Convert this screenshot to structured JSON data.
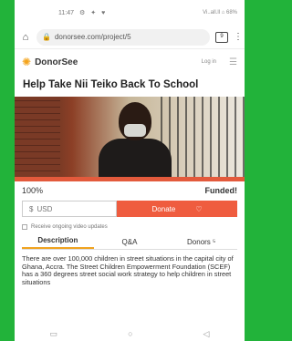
{
  "status_bar": {
    "time": "11:47",
    "left_icons": [
      "settings-icon",
      "bluetooth-icon",
      "wifi-icon"
    ],
    "right_text": "Vi..all.ll ⌂ 68%"
  },
  "browser": {
    "home_icon": "home-icon",
    "url": "donorsee.com/project/5",
    "lock_icon": "lock-icon",
    "tabs_count": "9",
    "menu_icon": "kebab-icon"
  },
  "site": {
    "logo": "DonorSee",
    "login": "Log in",
    "menu_icon": "hamburger-icon"
  },
  "project": {
    "title": "Help Take Nii Teiko Back To School",
    "progress_percent": 100,
    "progress_label": "100%",
    "funded_label": "Funded!"
  },
  "donation": {
    "currency_prefix": "$",
    "currency_placeholder": "USD",
    "donate_label": "Donate",
    "heart_icon": "heart-icon",
    "updates_label": "Receive ongoing video updates"
  },
  "tabs": [
    {
      "label": "Description",
      "active": true
    },
    {
      "label": "Q&A",
      "active": false
    },
    {
      "label": "Donors ⁵",
      "active": false
    }
  ],
  "description": "There are over 100,000 children in street situations in the capital city of Ghana, Accra. The Street Children Empowerment Foundation (SCEF) has a 360 degrees street social work strategy to help children in street situations",
  "nav": [
    "back-icon",
    "home-circle-icon",
    "recent-apps-icon"
  ],
  "colors": {
    "frame_green": "#22b33a",
    "accent_orange": "#ef5c3f",
    "tab_accent": "#f0a31f"
  }
}
